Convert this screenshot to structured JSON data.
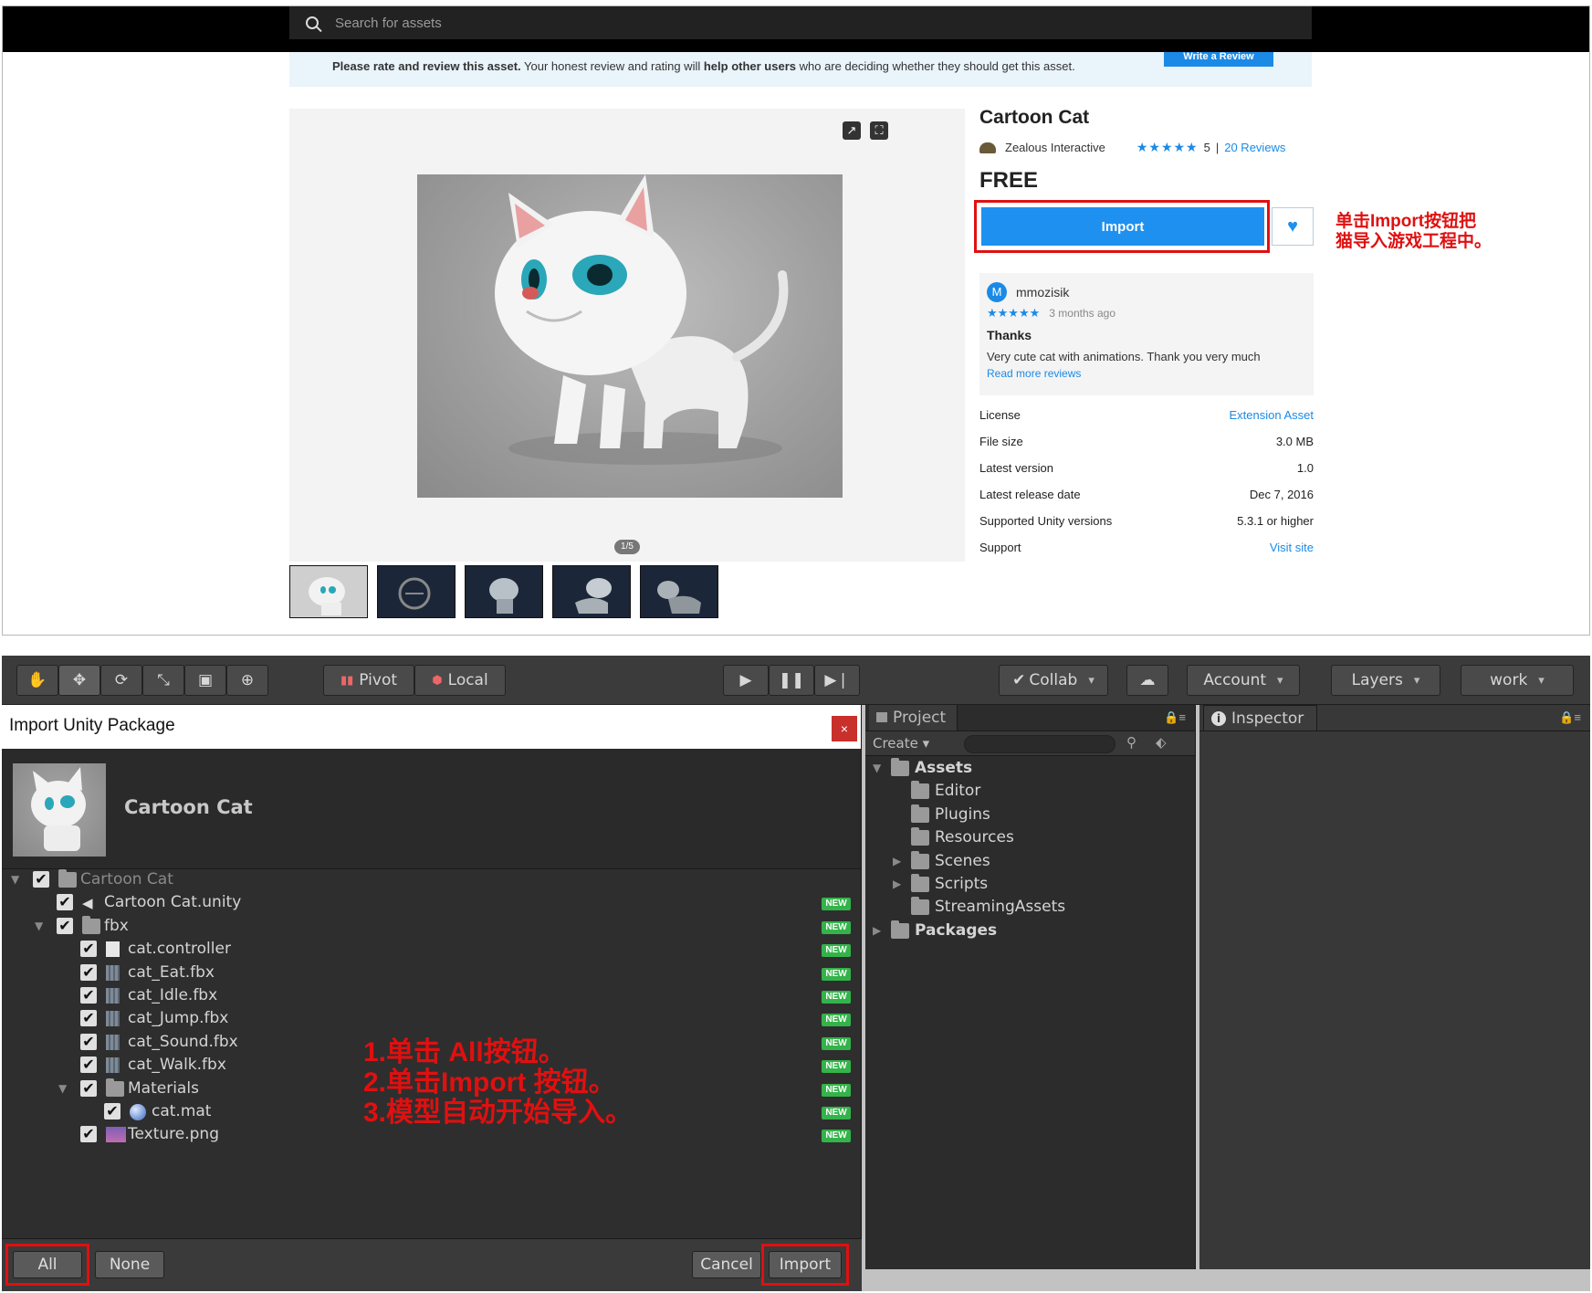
{
  "store": {
    "search_placeholder": "Search for assets",
    "rate_bar": {
      "bold1": "Please rate and review this asset.",
      "text1": " Your honest review and rating will ",
      "bold2": "help other users",
      "text2": " who are deciding whether they should get this asset.",
      "write_review": "Write a Review"
    },
    "pager": "1/5",
    "title": "Cartoon Cat",
    "publisher": "Zealous Interactive",
    "stars": "★★★★★",
    "score": "5",
    "separator": "|",
    "reviews_link": "20 Reviews",
    "price": "FREE",
    "import_label": "Import",
    "review": {
      "avatar_letter": "M",
      "user": "mmozisik",
      "stars": "★★★★★",
      "age": "3 months ago",
      "title": "Thanks",
      "body": "Very cute cat with animations. Thank you very much",
      "more": "Read more reviews"
    },
    "meta": [
      {
        "label": "License",
        "value": "Extension Asset",
        "link": true
      },
      {
        "label": "File size",
        "value": "3.0 MB",
        "link": false
      },
      {
        "label": "Latest version",
        "value": "1.0",
        "link": false
      },
      {
        "label": "Latest release date",
        "value": "Dec 7, 2016",
        "link": false
      },
      {
        "label": "Supported Unity versions",
        "value": "5.3.1 or higher",
        "link": false
      },
      {
        "label": "Support",
        "value": "Visit site",
        "link": true
      }
    ],
    "annotation_line1": "单击Import按钮把",
    "annotation_line2": "猫导入游戏工程中。"
  },
  "unity": {
    "toolbar": {
      "pivot": "Pivot",
      "local": "Local",
      "collab": "Collab",
      "account": "Account",
      "layers": "Layers",
      "layout": "work"
    },
    "dialog": {
      "title": "Import Unity Package",
      "close": "×",
      "package_name": "Cartoon Cat",
      "new_badge": "NEW",
      "items": [
        {
          "label": "Cartoon Cat",
          "depth": 0,
          "icon": "folder",
          "arrow": true,
          "dim": true,
          "new": false
        },
        {
          "label": "Cartoon Cat.unity",
          "depth": 1,
          "icon": "unity",
          "arrow": false,
          "dim": false,
          "new": true
        },
        {
          "label": "fbx",
          "depth": 1,
          "icon": "folder",
          "arrow": true,
          "dim": false,
          "new": true
        },
        {
          "label": "cat.controller",
          "depth": 2,
          "icon": "file",
          "arrow": false,
          "dim": false,
          "new": true
        },
        {
          "label": "cat_Eat.fbx",
          "depth": 2,
          "icon": "fbx",
          "arrow": false,
          "dim": false,
          "new": true
        },
        {
          "label": "cat_Idle.fbx",
          "depth": 2,
          "icon": "fbx",
          "arrow": false,
          "dim": false,
          "new": true
        },
        {
          "label": "cat_Jump.fbx",
          "depth": 2,
          "icon": "fbx",
          "arrow": false,
          "dim": false,
          "new": true
        },
        {
          "label": "cat_Sound.fbx",
          "depth": 2,
          "icon": "fbx",
          "arrow": false,
          "dim": false,
          "new": true
        },
        {
          "label": "cat_Walk.fbx",
          "depth": 2,
          "icon": "fbx",
          "arrow": false,
          "dim": false,
          "new": true
        },
        {
          "label": "Materials",
          "depth": 2,
          "icon": "folder",
          "arrow": true,
          "dim": false,
          "new": true
        },
        {
          "label": "cat.mat",
          "depth": 3,
          "icon": "mat",
          "arrow": false,
          "dim": false,
          "new": true
        },
        {
          "label": "Texture.png",
          "depth": 2,
          "icon": "tex",
          "arrow": false,
          "dim": false,
          "new": true
        }
      ],
      "instructions": [
        "1.单击 All按钮。",
        "2.单击Import 按钮。",
        "3.模型自动开始导入。"
      ],
      "all": "All",
      "none": "None",
      "cancel": "Cancel",
      "import": "Import"
    },
    "project": {
      "tab": "Project",
      "create": "Create ▾",
      "items": [
        {
          "label": "Assets",
          "depth": 0,
          "arrow": "▼",
          "bold": true
        },
        {
          "label": "Editor",
          "depth": 1,
          "arrow": "",
          "bold": false
        },
        {
          "label": "Plugins",
          "depth": 1,
          "arrow": "",
          "bold": false
        },
        {
          "label": "Resources",
          "depth": 1,
          "arrow": "",
          "bold": false
        },
        {
          "label": "Scenes",
          "depth": 1,
          "arrow": "▶",
          "bold": false
        },
        {
          "label": "Scripts",
          "depth": 1,
          "arrow": "▶",
          "bold": false
        },
        {
          "label": "StreamingAssets",
          "depth": 1,
          "arrow": "",
          "bold": false
        },
        {
          "label": "Packages",
          "depth": 0,
          "arrow": "▶",
          "bold": true
        }
      ]
    },
    "inspector": {
      "tab": "Inspector"
    }
  }
}
